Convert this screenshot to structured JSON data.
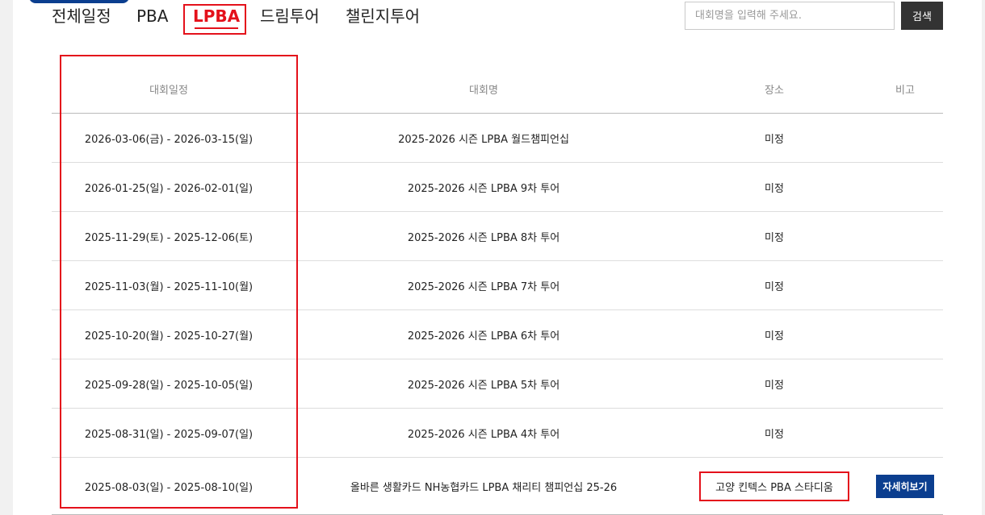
{
  "tabs": [
    {
      "label": "전체일정",
      "active": false
    },
    {
      "label": "PBA",
      "active": false
    },
    {
      "label": "LPBA",
      "active": true
    },
    {
      "label": "드림투어",
      "active": false
    },
    {
      "label": "챌린지투어",
      "active": false
    }
  ],
  "search": {
    "placeholder": "대회명을 입력해 주세요.",
    "value": "",
    "button_label": "검색"
  },
  "table": {
    "headers": [
      "대회일정",
      "대회명",
      "장소",
      "비고"
    ],
    "rows": [
      {
        "date": "2026-03-06(금) - 2026-03-15(일)",
        "name": "2025-2026 시즌 LPBA 월드챔피언십",
        "venue": "미정",
        "note": ""
      },
      {
        "date": "2026-01-25(일) - 2026-02-01(일)",
        "name": "2025-2026 시즌 LPBA 9차 투어",
        "venue": "미정",
        "note": ""
      },
      {
        "date": "2025-11-29(토) - 2025-12-06(토)",
        "name": "2025-2026 시즌 LPBA 8차 투어",
        "venue": "미정",
        "note": ""
      },
      {
        "date": "2025-11-03(월) - 2025-11-10(월)",
        "name": "2025-2026 시즌 LPBA 7차 투어",
        "venue": "미정",
        "note": ""
      },
      {
        "date": "2025-10-20(월) - 2025-10-27(월)",
        "name": "2025-2026 시즌 LPBA 6차 투어",
        "venue": "미정",
        "note": ""
      },
      {
        "date": "2025-09-28(일) - 2025-10-05(일)",
        "name": "2025-2026 시즌 LPBA 5차 투어",
        "venue": "미정",
        "note": ""
      },
      {
        "date": "2025-08-31(일) - 2025-09-07(일)",
        "name": "2025-2026 시즌 LPBA 4차 투어",
        "venue": "미정",
        "note": ""
      },
      {
        "date": "2025-08-03(일) - 2025-08-10(일)",
        "name": "올바른 생활카드 NH농협카드 LPBA 채리티 챔피언십 25-26",
        "venue": "고양 킨텍스 PBA 스타디움",
        "note": "자세히보기"
      }
    ]
  },
  "colors": {
    "accent": "#e4111b",
    "brand": "#0b3e8f",
    "search_button": "#333333"
  }
}
